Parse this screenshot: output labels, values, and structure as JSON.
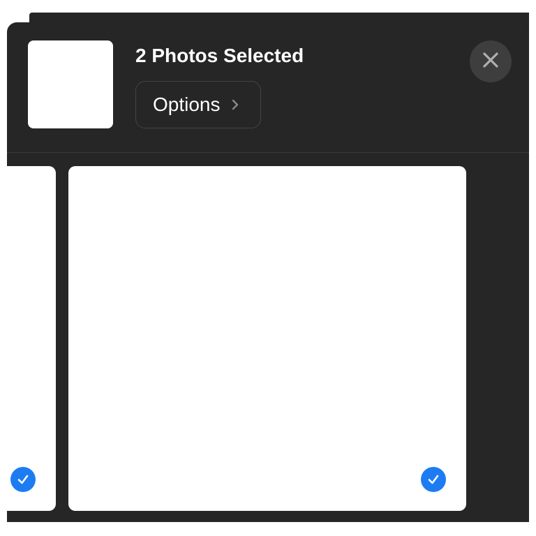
{
  "header": {
    "title": "2 Photos Selected",
    "options_label": "Options"
  },
  "icons": {
    "close": "close-icon",
    "chevron": "chevron-right-icon",
    "check": "checkmark-icon"
  },
  "photos": [
    {
      "selected": true
    },
    {
      "selected": true
    }
  ],
  "colors": {
    "sheet_background": "#262626",
    "close_button_background": "#3e3e3e",
    "selection_accent": "#1d7cf2",
    "text": "#ffffff"
  }
}
